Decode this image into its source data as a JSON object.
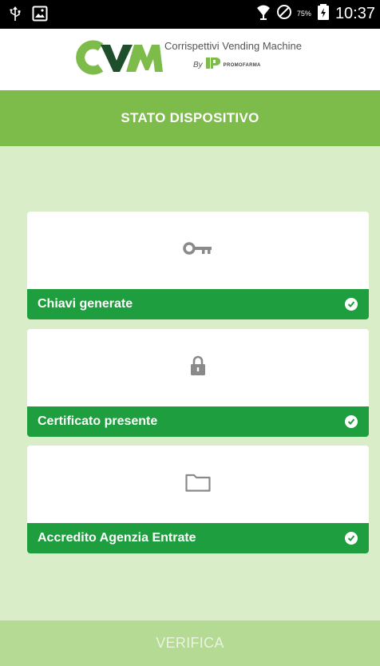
{
  "status_bar": {
    "time": "10:37",
    "battery_percent": "75%",
    "icons": [
      "usb-icon",
      "image-icon",
      "wifi-icon",
      "do-not-disturb-icon",
      "battery-icon"
    ]
  },
  "header": {
    "logo_text": "CVM",
    "app_name": "Corrispettivi Vending Machine",
    "by_label": "By",
    "brand_name": "PROMOFARMA",
    "colors": {
      "green": "#7dbb4a",
      "dark": "#1f4f2a"
    }
  },
  "screen_title": "STATO DISPOSITIVO",
  "items": [
    {
      "label": "Chiavi generate",
      "icon": "key-icon",
      "status": "check-icon"
    },
    {
      "label": "Certificato presente",
      "icon": "lock-icon",
      "status": "check-icon"
    },
    {
      "label": "Accredito Agenzia Entrate",
      "icon": "folder-icon",
      "status": "check-icon"
    }
  ],
  "verify_button": {
    "label": "VERIFICA"
  },
  "colors": {
    "background": "#d9edc9",
    "title_bar": "#7dbb4a",
    "item_strip": "#1f9e3f",
    "verify_button": "#b5da93"
  }
}
